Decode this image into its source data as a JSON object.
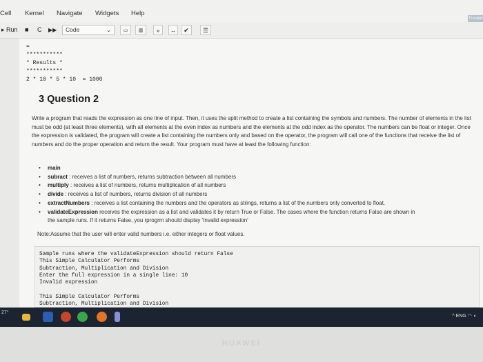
{
  "menu": {
    "items": [
      "Cell",
      "Kernel",
      "Navigate",
      "Widgets",
      "Help"
    ],
    "badge": "Trusted"
  },
  "toolbar": {
    "run_label": "Run",
    "cell_type": "Code"
  },
  "output_lines": [
    "=",
    "***********",
    "* Results *",
    "***********",
    "2 * 10 * 5 * 10  = 1000"
  ],
  "question": {
    "heading": "3 Question 2",
    "paragraph": "Write a program that reads the expression as one line of input. Then, it uses the split method to create a list containing the symbols and numbers. The number of elements in the list must be odd (at least three elements), with all elements at the even index as numbers and the elements at the odd index as the operator. The numbers can be float or integer. Once the expression is validated, the program will create a list containing the numbers only and based on the operator, the program will call one of the functions that receive the list of numbers and do the proper operation and return the result. Your program must have at least the following function:",
    "bullets": [
      {
        "name": "main",
        "desc": ""
      },
      {
        "name": "subract",
        "desc": " : receives a list of numbers, returns subtraction between all numbers"
      },
      {
        "name": "multiply",
        "desc": " : receives a list of numbers, returns multiplication of all numbers"
      },
      {
        "name": "divide",
        "desc": " : receives a list of numbers, returns division of all numbers"
      },
      {
        "name": "extractNumbers",
        "desc": " : receives a list containing the numbers and the operators as strings, returns a list of the numbers only converted to float."
      },
      {
        "name": "validateExpression",
        "desc": " receives the expression as a list and validates it by return True or False. The cases where the function returns False are shown in"
      }
    ],
    "bullet_continuation": "the sample runs. If it returns False, you rprogrm should display 'Invalid expression'",
    "note": "Note:Assume that the user will enter valid numbers i.e. either integers or float values.",
    "sample_lines": [
      "Sample runs where the validateExpression should return False",
      "This Simple Calculator Performs",
      "Subtraction, Multiplication and Division",
      "Enter the full expression in a single line: 10",
      "Invalid expression",
      "",
      "This Simple Calculator Performs",
      "Subtraction, Multiplication and Division"
    ]
  },
  "taskbar": {
    "weather": "27°",
    "tray_lang": "ENG"
  },
  "bezel": {
    "brand": "HUAWEI"
  }
}
